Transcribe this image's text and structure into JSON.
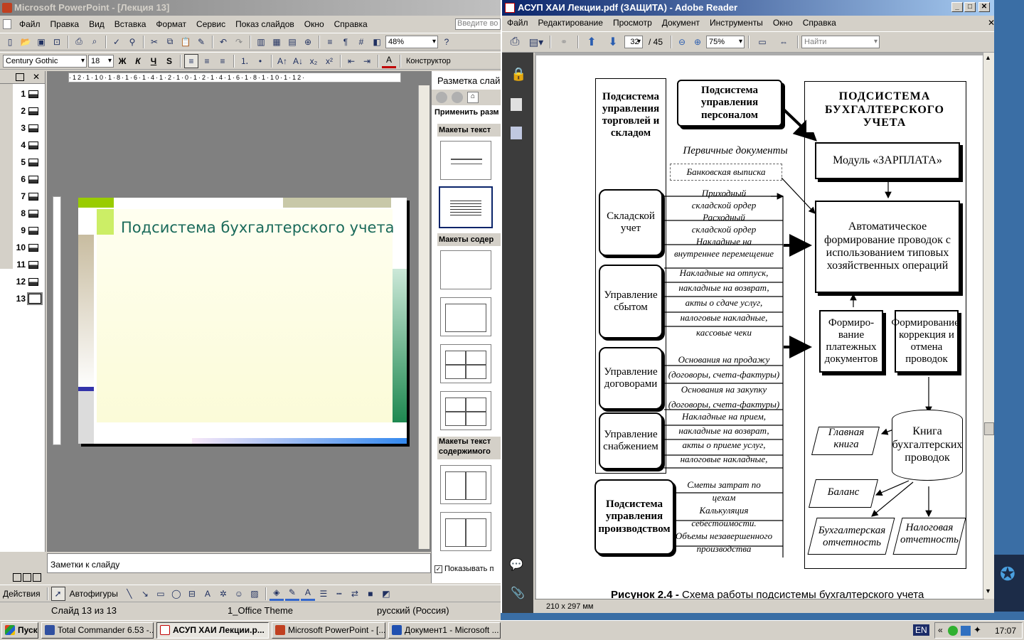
{
  "powerpoint": {
    "title": "Microsoft PowerPoint - [Лекция 13]",
    "menu": [
      "Файл",
      "Правка",
      "Вид",
      "Вставка",
      "Формат",
      "Сервис",
      "Показ слайдов",
      "Окно",
      "Справка"
    ],
    "ask_box": "Введите во",
    "zoom": "48%",
    "font_name": "Century Gothic",
    "font_size": "18",
    "designer_button": "Конструктор",
    "slide_numbers": [
      "1",
      "2",
      "3",
      "4",
      "5",
      "6",
      "7",
      "8",
      "9",
      "10",
      "11",
      "12",
      "13"
    ],
    "slide_title": "Подсистема бухгалтерского учета",
    "notes_placeholder": "Заметки к слайду",
    "task_pane": {
      "title": "Разметка слай",
      "apply_label": "Применить разм",
      "section_text": "Макеты текст",
      "section_content": "Макеты содер",
      "section_text_content_1": "Макеты текст",
      "section_text_content_2": "содержимого",
      "show_checkbox": "Показывать п"
    },
    "drawing_toolbar": {
      "actions": "Действия",
      "autoshapes": "Автофигуры"
    },
    "status": {
      "slide": "Слайд 13 из 13",
      "theme": "1_Office Theme",
      "language": "русский (Россия)"
    }
  },
  "reader": {
    "title": "АСУП  ХАИ Лекции.pdf (ЗАЩИТА) - Adobe Reader",
    "menu": [
      "Файл",
      "Редактирование",
      "Просмотр",
      "Документ",
      "Инструменты",
      "Окно",
      "Справка"
    ],
    "page_current": "32",
    "page_total": "/ 45",
    "zoom": "75%",
    "search_placeholder": "Найти",
    "page_size": "210 x 297 мм",
    "figure_caption_bold": "Рисунок 2.4 -",
    "figure_caption": " Схема работы подсистемы бухгалтерского учета",
    "diagram": {
      "left_header": "Подсистема управления торговлей и складом",
      "personnel": "Подсистема управления персоналом",
      "primary_docs": "Первичные документы",
      "bank_statement": "Банковская выписка",
      "warehouse": "Складской учет",
      "sales": "Управление сбытом",
      "contracts": "Управление договорами",
      "supply": "Управление снабжением",
      "production": "Подсистема управления производством",
      "warehouse_docs": [
        "Приходный",
        "складской ордер",
        "Расходный",
        "складской ордер",
        "Накладные на",
        "внутреннее перемещение"
      ],
      "sales_docs": [
        "Накладные на отпуск,",
        "накладные на возврат,",
        "акты о сдаче услуг,",
        "налоговые накладные,",
        "кассовые чеки"
      ],
      "contract_docs": [
        "Основания на продажу",
        "(договоры, счета-фактуры)",
        "Основания на закупку",
        "(договоры, счета-фактуры)"
      ],
      "supply_docs": [
        "Накладные на прием,",
        "накладные на возврат,",
        "акты о приеме услуг,",
        "налоговые накладные,"
      ],
      "production_docs": [
        "Сметы затрат по",
        "цехам",
        "Калькуляция",
        "себестоимости.",
        "Объемы незавершенного",
        "производства"
      ],
      "acc_header": "ПОДСИСТЕМА БУХГАЛТЕРСКОГО УЧЕТА",
      "salary_module": "Модуль «ЗАРПЛАТА»",
      "auto_posting": "Автоматическое формирование проводок с использованием типовых хозяйственных операций",
      "payment_docs": "Формиро-вание платежных документов",
      "posting_correction": "Формирование, коррекция и отмена проводок",
      "posting_book": "Книга бухгалтерских проводок",
      "general_ledger": "Главная книга",
      "balance": "Баланс",
      "acc_reporting": "Бухгалтерская отчетность",
      "tax_reporting": "Налоговая отчетность"
    }
  },
  "taskbar": {
    "start": "Пуск",
    "tasks": [
      "Total Commander 6.53 -...",
      "АСУП  ХАИ Лекции.р...",
      "Microsoft PowerPoint - [...",
      "Документ1 - Microsoft ..."
    ],
    "lang": "EN",
    "time": "17:07"
  }
}
